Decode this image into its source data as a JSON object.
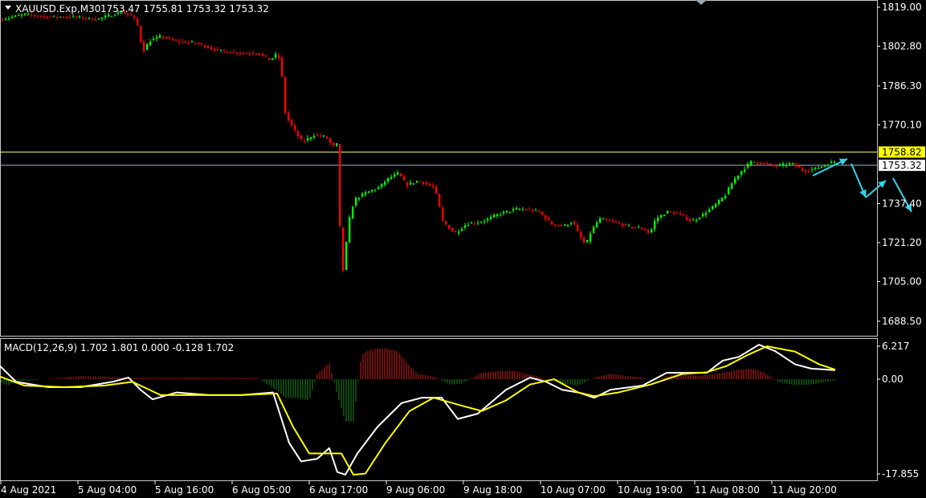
{
  "header": {
    "symbol_label": "XAUUSD.Exp,M30",
    "ohlc_label": "1753.47 1755.81 1753.32 1753.32"
  },
  "indicator": {
    "label": "MACD(12,26,9) 1.702 1.801 0.000 -0.128 1.702"
  },
  "colors": {
    "background": "#000000",
    "up_candle": "#00ff00",
    "down_candle": "#ff0000",
    "axis": "#ffffff",
    "h_line_yellow": "#ffff66",
    "h_line_grey": "#a0b4c8",
    "arrow": "#2fd6e8",
    "macd_main": "#ffffff",
    "macd_signal": "#ffff00",
    "hist_pos": "#d21e1e",
    "hist_neg": "#1e8c1e"
  },
  "chart_data": [
    {
      "type": "candlestick",
      "title": "XAUUSD.Exp,M30",
      "ylim": [
        1680,
        1822
      ],
      "y_ticks": [
        "1819.00",
        "1802.80",
        "1786.30",
        "1770.10",
        "1737.40",
        "1721.20",
        "1705.00",
        "1688.50"
      ],
      "x_ticks": [
        "4 Aug 2021",
        "5 Aug 04:00",
        "5 Aug 16:00",
        "6 Aug 05:00",
        "6 Aug 17:00",
        "9 Aug 06:00",
        "9 Aug 18:00",
        "10 Aug 07:00",
        "10 Aug 19:00",
        "11 Aug 08:00",
        "11 Aug 20:00"
      ],
      "levels": [
        {
          "value": 1758.82,
          "label": "1758.82",
          "color": "#ffff66"
        },
        {
          "value": 1753.32,
          "label": "1753.32",
          "color": "#a0b4c8"
        }
      ],
      "price_path": [
        [
          0,
          1814
        ],
        [
          30,
          1816
        ],
        [
          60,
          1815
        ],
        [
          90,
          1815
        ],
        [
          120,
          1814
        ],
        [
          150,
          1817
        ],
        [
          165,
          1815
        ],
        [
          172,
          1810
        ],
        [
          176,
          1800
        ],
        [
          185,
          1805
        ],
        [
          200,
          1807
        ],
        [
          215,
          1805
        ],
        [
          245,
          1804
        ],
        [
          270,
          1801
        ],
        [
          300,
          1800
        ],
        [
          320,
          1800
        ],
        [
          335,
          1797
        ],
        [
          345,
          1800
        ],
        [
          350,
          1790
        ],
        [
          352,
          1777
        ],
        [
          358,
          1772
        ],
        [
          365,
          1768
        ],
        [
          375,
          1763
        ],
        [
          390,
          1766
        ],
        [
          405,
          1765
        ],
        [
          413,
          1761
        ],
        [
          418,
          1762
        ],
        [
          421,
          1752
        ],
        [
          423,
          1703
        ],
        [
          427,
          1712
        ],
        [
          433,
          1730
        ],
        [
          440,
          1739
        ],
        [
          455,
          1742
        ],
        [
          470,
          1744
        ],
        [
          483,
          1748
        ],
        [
          495,
          1750
        ],
        [
          505,
          1745
        ],
        [
          520,
          1747
        ],
        [
          540,
          1744
        ],
        [
          550,
          1730
        ],
        [
          565,
          1725
        ],
        [
          580,
          1729
        ],
        [
          600,
          1730
        ],
        [
          620,
          1733
        ],
        [
          640,
          1735
        ],
        [
          655,
          1735
        ],
        [
          670,
          1734
        ],
        [
          685,
          1729
        ],
        [
          700,
          1728
        ],
        [
          712,
          1730
        ],
        [
          720,
          1724
        ],
        [
          728,
          1720
        ],
        [
          735,
          1726
        ],
        [
          745,
          1731
        ],
        [
          760,
          1730
        ],
        [
          780,
          1728
        ],
        [
          800,
          1727
        ],
        [
          808,
          1725
        ],
        [
          815,
          1731
        ],
        [
          830,
          1734
        ],
        [
          845,
          1733
        ],
        [
          860,
          1730
        ],
        [
          875,
          1733
        ],
        [
          890,
          1737
        ],
        [
          902,
          1741
        ],
        [
          912,
          1747
        ],
        [
          922,
          1751
        ],
        [
          935,
          1755
        ],
        [
          950,
          1754
        ],
        [
          965,
          1753
        ],
        [
          985,
          1754
        ],
        [
          1000,
          1751
        ],
        [
          1015,
          1752
        ],
        [
          1030,
          1754
        ],
        [
          1040,
          1755
        ]
      ],
      "annotation_arrows": [
        [
          [
            1012,
            1749
          ],
          [
            1055,
            1756
          ]
        ],
        [
          [
            1060,
            1754
          ],
          [
            1078,
            1740
          ]
        ],
        [
          [
            1078,
            1740
          ],
          [
            1103,
            1747
          ]
        ],
        [
          [
            1112,
            1748
          ],
          [
            1135,
            1734
          ]
        ]
      ]
    },
    {
      "type": "line",
      "title": "MACD(12,26,9)",
      "ylim": [
        -19,
        7.5
      ],
      "y_ticks": [
        "6.217",
        "0.00",
        "-17.855"
      ],
      "series": [
        {
          "name": "macd",
          "points": [
            [
              0,
              2.5
            ],
            [
              20,
              -0.5
            ],
            [
              60,
              -1.5
            ],
            [
              100,
              -1.5
            ],
            [
              140,
              -0.5
            ],
            [
              160,
              0.3
            ],
            [
              175,
              -2
            ],
            [
              190,
              -3.8
            ],
            [
              220,
              -2.5
            ],
            [
              260,
              -3
            ],
            [
              300,
              -3
            ],
            [
              340,
              -2.5
            ],
            [
              360,
              -12
            ],
            [
              375,
              -15.5
            ],
            [
              395,
              -15
            ],
            [
              410,
              -13
            ],
            [
              420,
              -17.5
            ],
            [
              430,
              -18
            ],
            [
              445,
              -14
            ],
            [
              470,
              -9
            ],
            [
              500,
              -4.5
            ],
            [
              525,
              -3.5
            ],
            [
              550,
              -3.5
            ],
            [
              570,
              -7.5
            ],
            [
              595,
              -6.5
            ],
            [
              630,
              -2
            ],
            [
              660,
              0.3
            ],
            [
              680,
              -0.5
            ],
            [
              700,
              -2
            ],
            [
              720,
              -2.5
            ],
            [
              740,
              -3.5
            ],
            [
              760,
              -2
            ],
            [
              800,
              -1.2
            ],
            [
              830,
              1.2
            ],
            [
              860,
              1.2
            ],
            [
              880,
              1.2
            ],
            [
              900,
              3.5
            ],
            [
              920,
              4.2
            ],
            [
              945,
              6.5
            ],
            [
              965,
              5.3
            ],
            [
              990,
              2.8
            ],
            [
              1010,
              2
            ],
            [
              1040,
              1.7
            ]
          ]
        },
        {
          "name": "signal",
          "points": [
            [
              0,
              0.5
            ],
            [
              30,
              -1.2
            ],
            [
              80,
              -1.5
            ],
            [
              130,
              -1.2
            ],
            [
              165,
              -0.5
            ],
            [
              200,
              -3
            ],
            [
              250,
              -3
            ],
            [
              300,
              -3
            ],
            [
              345,
              -2.7
            ],
            [
              365,
              -9
            ],
            [
              385,
              -14
            ],
            [
              405,
              -14
            ],
            [
              425,
              -14
            ],
            [
              440,
              -18
            ],
            [
              455,
              -17.8
            ],
            [
              480,
              -12
            ],
            [
              510,
              -6
            ],
            [
              540,
              -3.5
            ],
            [
              575,
              -5
            ],
            [
              600,
              -6
            ],
            [
              630,
              -4
            ],
            [
              660,
              -1
            ],
            [
              690,
              0
            ],
            [
              720,
              -2.5
            ],
            [
              740,
              -3.2
            ],
            [
              770,
              -2.5
            ],
            [
              810,
              -1
            ],
            [
              850,
              1
            ],
            [
              880,
              1.3
            ],
            [
              905,
              2.5
            ],
            [
              930,
              4.5
            ],
            [
              955,
              6.2
            ],
            [
              990,
              5.2
            ],
            [
              1020,
              2.8
            ],
            [
              1040,
              1.8
            ]
          ]
        }
      ],
      "histogram": [
        [
          0,
          -0.6
        ],
        [
          10,
          -1.2
        ],
        [
          20,
          -0.4
        ],
        [
          40,
          -0.2
        ],
        [
          80,
          0.3
        ],
        [
          100,
          0.6
        ],
        [
          130,
          0.5
        ],
        [
          160,
          0.3
        ],
        [
          200,
          0.2
        ],
        [
          240,
          0.3
        ],
        [
          280,
          0.2
        ],
        [
          320,
          0.2
        ],
        [
          345,
          -2
        ],
        [
          355,
          -3.5
        ],
        [
          370,
          -3.5
        ],
        [
          385,
          -4
        ],
        [
          395,
          1
        ],
        [
          410,
          3
        ],
        [
          420,
          -3
        ],
        [
          430,
          -8
        ],
        [
          440,
          -8
        ],
        [
          450,
          4.5
        ],
        [
          460,
          5.5
        ],
        [
          470,
          5.8
        ],
        [
          480,
          5.8
        ],
        [
          495,
          5.3
        ],
        [
          510,
          2.5
        ],
        [
          520,
          1
        ],
        [
          540,
          0.5
        ],
        [
          560,
          -1
        ],
        [
          575,
          -0.8
        ],
        [
          600,
          1.2
        ],
        [
          620,
          1.5
        ],
        [
          640,
          1.6
        ],
        [
          650,
          1.2
        ],
        [
          670,
          0.5
        ],
        [
          700,
          -0.8
        ],
        [
          720,
          -1.2
        ],
        [
          740,
          0.3
        ],
        [
          760,
          1
        ],
        [
          780,
          0.6
        ],
        [
          800,
          0.3
        ],
        [
          815,
          -0.4
        ],
        [
          830,
          0.6
        ],
        [
          850,
          1
        ],
        [
          870,
          0.6
        ],
        [
          900,
          1.2
        ],
        [
          920,
          1.8
        ],
        [
          935,
          2
        ],
        [
          950,
          1.4
        ],
        [
          970,
          -0.6
        ],
        [
          990,
          -1.1
        ],
        [
          1010,
          -1
        ],
        [
          1025,
          -0.6
        ],
        [
          1040,
          -0.2
        ]
      ]
    }
  ]
}
